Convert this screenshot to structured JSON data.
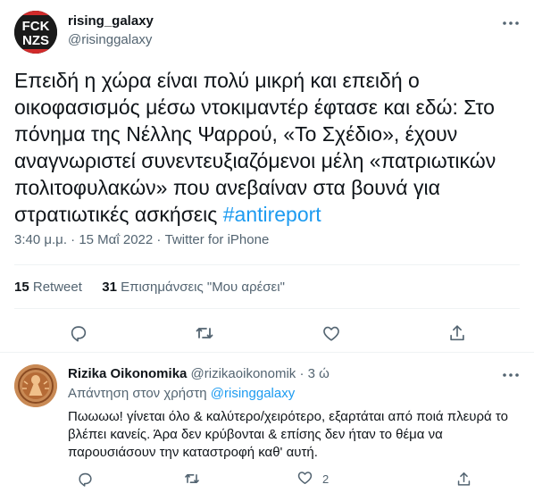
{
  "tweet": {
    "avatar_text_top": "FCK",
    "avatar_text_bottom": "NZS",
    "name": "rising_galaxy",
    "handle": "@risinggalaxy",
    "text": "Επειδή η χώρα είναι πολύ μικρή και επειδή ο οικοφασισμός μέσω ντοκιμαντέρ έφτασε και εδώ: Στο πόνημα της Νέλλης Ψαρρού, «Το Σχέδιο», έχουν αναγνωριστεί συνεντευξιαζόμενοι μέλη «πατριωτικών πολιτοφυλακών» που ανεβαίναν στα βουνά για στρατιωτικές ασκήσεις ",
    "hashtag": "#antireport",
    "time": "3:40 μ.μ.",
    "separator": " · ",
    "date": "15 Μαΐ 2022",
    "source": "Twitter for iPhone",
    "retweet_count": "15",
    "retweet_label": " Retweet",
    "like_count": "31",
    "like_label": " Επισημάνσεις \"Μου αρέσει\""
  },
  "reply": {
    "name": "Rizika Oikonomika",
    "handle": "@rizikaoikonomik",
    "time_sep": " · ",
    "time": "3 ώ",
    "replying_to_label": "Απάντηση στον χρήστη ",
    "replying_to_mention": "@risinggalaxy",
    "text": "Πωωωω! γίνεται όλο & καλύτερο/χειρότερο, εξαρτάται από ποιά πλευρά το βλέπει κανείς. Άρα δεν κρύβονται & επίσης δεν ήταν το θέμα να παρουσιάσουν την καταστροφή καθ' αυτή.",
    "like_count": "2"
  },
  "colors": {
    "accent": "#1d9bf0",
    "secondary_text": "#536471",
    "primary_text": "#0f1419",
    "divider": "#eff3f4"
  },
  "icons": [
    "more-icon",
    "reply-icon",
    "retweet-icon",
    "like-icon",
    "share-icon"
  ]
}
